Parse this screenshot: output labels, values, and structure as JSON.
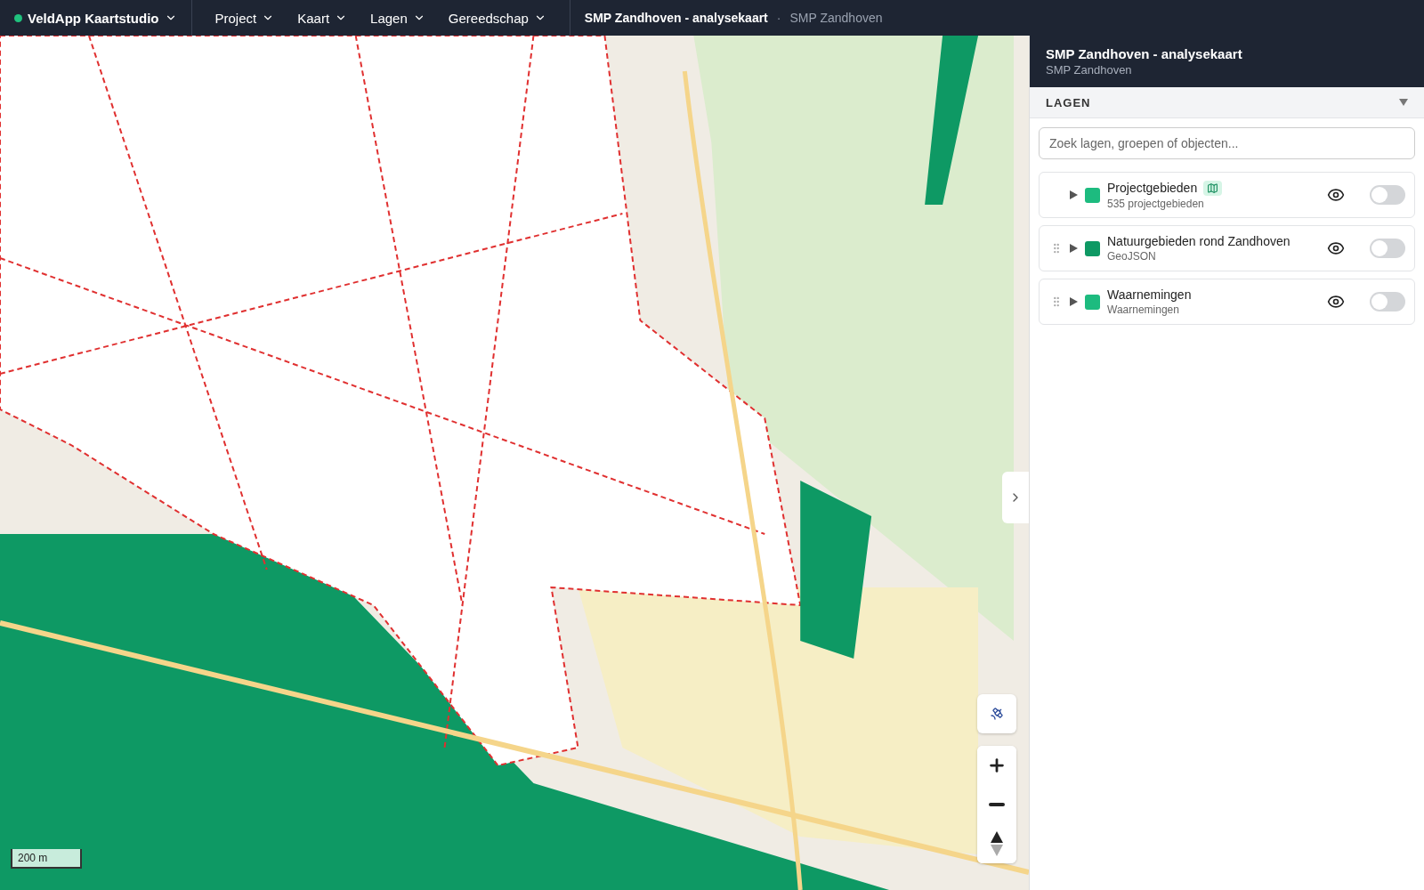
{
  "topbar": {
    "app": {
      "name": "VeldApp Kaartstudio",
      "online": true
    },
    "menus": [
      {
        "label": "Project"
      },
      {
        "label": "Kaart"
      },
      {
        "label": "Lagen"
      },
      {
        "label": "Gereedschap"
      }
    ],
    "document": {
      "title": "SMP Zandhoven - analysekaart",
      "separator": "·",
      "subtitle": "SMP Zandhoven"
    }
  },
  "map": {
    "scale": "200 m"
  },
  "sidebar": {
    "title": "SMP Zandhoven - analysekaart",
    "subtitle": "SMP Zandhoven",
    "section": {
      "label": "LAGEN",
      "expanded": true
    },
    "search": {
      "placeholder": "Zoek lagen, groepen of objecten..."
    },
    "layers": [
      {
        "name": "Projectgebieden",
        "meta": "535 projectgebieden",
        "color": "#1dbb7f",
        "draggable": false,
        "badge": true,
        "on": false
      },
      {
        "name": "Natuurgebieden rond Zandhoven",
        "meta": "GeoJSON",
        "color": "#0e9964",
        "draggable": true,
        "badge": false,
        "on": false
      },
      {
        "name": "Waarnemingen",
        "meta": "Waarnemingen",
        "color": "#1dbb7f",
        "draggable": true,
        "badge": false,
        "on": false
      }
    ]
  }
}
